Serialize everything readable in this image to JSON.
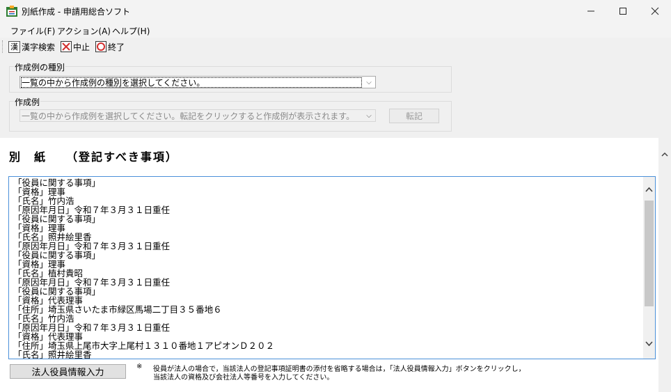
{
  "window": {
    "title": "別紙作成 - 申請用総合ソフト",
    "controls": {
      "minimize": "—",
      "maximize": "☐",
      "close": "✕"
    }
  },
  "menu": [
    {
      "label": "ファイル(F)"
    },
    {
      "label": "アクション(A)"
    },
    {
      "label": "ヘルプ(H)"
    }
  ],
  "toolbar": {
    "kanji_label": "漢字検索",
    "kanji_icon_text": "漢",
    "stop_label": "中止",
    "exit_label": "終了"
  },
  "type_group": {
    "label": "作成例の種別",
    "value": "一覧の中から作成例の種別を選択してください。"
  },
  "example_group": {
    "label": "作成例",
    "placeholder": "一覧の中から作成例を選択してください。転記をクリックすると作成例が表示されます。",
    "transfer_button": "転記"
  },
  "main": {
    "heading": "別　紙　　（登記すべき事項）",
    "lines": [
      "「役員に関する事項」",
      "「資格」理事",
      "「氏名」竹内浩",
      "「原因年月日」令和７年３月３１日重任",
      "「役員に関する事項」",
      "「資格」理事",
      "「氏名」照井絵里香",
      "「原因年月日」令和７年３月３１日重任",
      "「役員に関する事項」",
      "「資格」理事",
      "「氏名」植村貴昭",
      "「原因年月日」令和７年３月３１日重任",
      "「役員に関する事項」",
      "「資格」代表理事",
      "「住所」埼玉県さいたま市緑区馬場二丁目３５番地６",
      "「氏名」竹内浩",
      "「原因年月日」令和７年３月３１日重任",
      "「資格」代表理事",
      "「住所」埼玉県上尾市大字上尾村１３１０番地１アピオンＤ２０２",
      "「氏名」照井絵里香"
    ],
    "corp_officer_button": "法人役員情報入力",
    "note_mark": "※",
    "note_line1": "役員が法人の場合で，当該法人の登記事項証明書の添付を省略する場合は，「法人役員情報入力」ボタンをクリックし，",
    "note_line2": "当該法人の資格及び会社法人等番号を入力してください。"
  },
  "colors": {
    "accent": "#4a90d9",
    "stop_red": "#d32f2f"
  }
}
